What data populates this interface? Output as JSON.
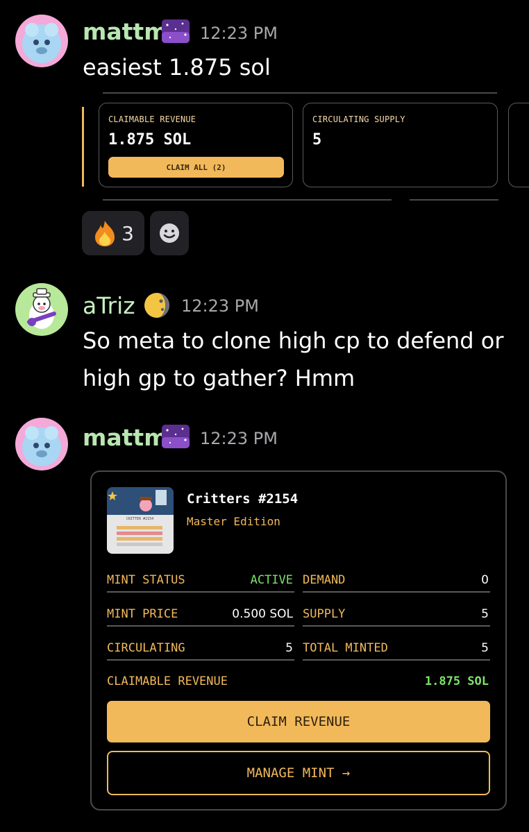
{
  "messages": [
    {
      "author": "mattm",
      "time": "12:23 PM",
      "text": "easiest 1.875 sol",
      "avatar_icon": "fluffy-blue-creature-avatar",
      "badge_icon": "galaxy-badge-icon"
    },
    {
      "author": "aTriz",
      "time": "12:23 PM",
      "text_line1": "So meta to clone high cp to defend or",
      "text_line2": "high gp to gather? Hmm",
      "avatar_icon": "cow-with-guitar-avatar",
      "badge_icon": "moon-icon"
    },
    {
      "author": "mattm",
      "time": "12:23 PM",
      "avatar_icon": "fluffy-blue-creature-avatar",
      "badge_icon": "galaxy-badge-icon"
    }
  ],
  "screenshot_cards": {
    "claimable": {
      "label": "CLAIMABLE REVENUE",
      "value": "1.875 SOL",
      "button": "CLAIM ALL (2)"
    },
    "circulating": {
      "label": "CIRCULATING SUPPLY",
      "value": "5"
    }
  },
  "reactions": [
    {
      "icon": "fire-icon",
      "count": "3"
    },
    {
      "icon": "add-reaction-icon"
    }
  ],
  "embed": {
    "title": "Critters #2154",
    "subtitle": "Master Edition",
    "thumb_caption": "CRITTER #2154",
    "rows": [
      {
        "left_label": "MINT STATUS",
        "left_value": "ACTIVE",
        "right_label": "DEMAND",
        "right_value": "0"
      },
      {
        "left_label": "MINT PRICE",
        "left_value": "0.500 SOL",
        "right_label": "SUPPLY",
        "right_value": "5"
      },
      {
        "left_label": "CIRCULATING",
        "left_value": "5",
        "right_label": "TOTAL MINTED",
        "right_value": "5"
      }
    ],
    "claimable_label": "CLAIMABLE REVENUE",
    "claimable_value": "1.875 SOL",
    "claim_button": "CLAIM REVENUE",
    "manage_button": "MANAGE MINT →",
    "colors": {
      "accent": "#f2b95b",
      "active": "#7ee26a"
    }
  }
}
